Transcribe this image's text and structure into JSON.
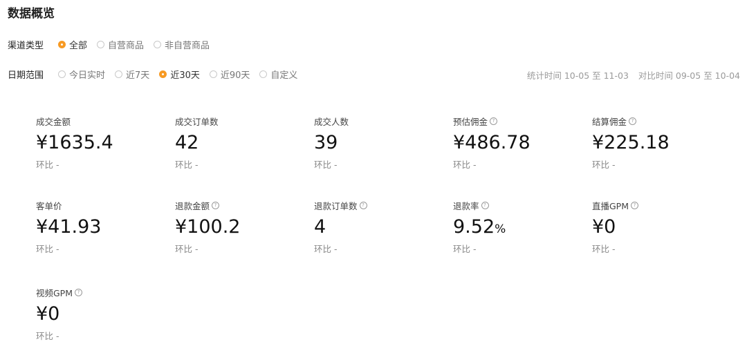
{
  "page_title": "数据概览",
  "channel": {
    "label": "渠道类型",
    "options": [
      "全部",
      "自营商品",
      "非自营商品"
    ],
    "selected": "全部"
  },
  "date_range": {
    "label": "日期范围",
    "options": [
      "今日实时",
      "近7天",
      "近30天",
      "近90天",
      "自定义"
    ],
    "selected": "近30天"
  },
  "stat_time": "统计时间 10-05 至 11-03",
  "compare_time": "对比时间 09-05 至 10-04",
  "colors": {
    "accent": "#f79a23"
  },
  "metrics": [
    {
      "label": "成交金额",
      "value": "¥1635.4",
      "unit": "",
      "compare": "环比 -",
      "help": false
    },
    {
      "label": "成交订单数",
      "value": "42",
      "unit": "",
      "compare": "环比 -",
      "help": false
    },
    {
      "label": "成交人数",
      "value": "39",
      "unit": "",
      "compare": "环比 -",
      "help": false
    },
    {
      "label": "预估佣金",
      "value": "¥486.78",
      "unit": "",
      "compare": "环比 -",
      "help": true
    },
    {
      "label": "结算佣金",
      "value": "¥225.18",
      "unit": "",
      "compare": "环比 -",
      "help": true
    },
    {
      "label": "客单价",
      "value": "¥41.93",
      "unit": "",
      "compare": "环比 -",
      "help": false
    },
    {
      "label": "退款金额",
      "value": "¥100.2",
      "unit": "",
      "compare": "环比 -",
      "help": true
    },
    {
      "label": "退款订单数",
      "value": "4",
      "unit": "",
      "compare": "环比 -",
      "help": true
    },
    {
      "label": "退款率",
      "value": "9.52",
      "unit": "%",
      "compare": "环比 -",
      "help": true
    },
    {
      "label": "直播GPM",
      "value": "¥0",
      "unit": "",
      "compare": "环比 -",
      "help": true
    },
    {
      "label": "视频GPM",
      "value": "¥0",
      "unit": "",
      "compare": "环比 -",
      "help": true
    }
  ]
}
